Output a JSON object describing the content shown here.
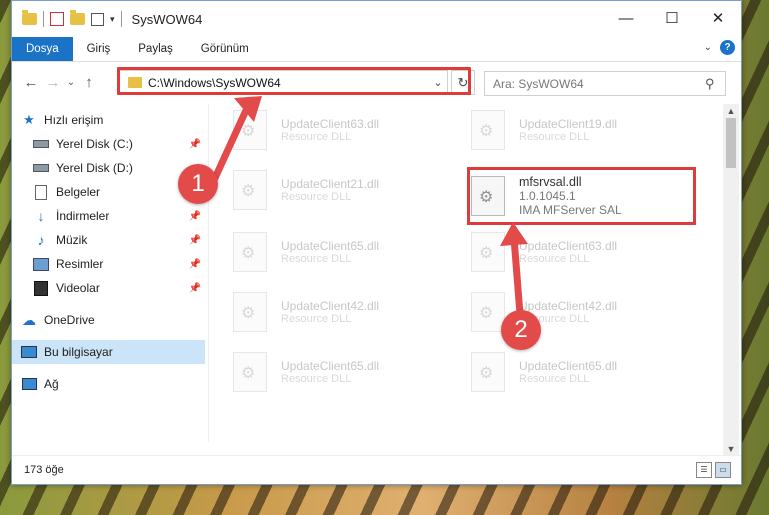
{
  "window": {
    "title": "SysWOW64",
    "controls": {
      "minimize": "—",
      "maximize": "☐",
      "close": "✕"
    }
  },
  "ribbon": {
    "tabs": [
      "Dosya",
      "Giriş",
      "Paylaş",
      "Görünüm"
    ],
    "expand_icon": "chevron-down-icon",
    "help_label": "?"
  },
  "nav": {
    "back": "←",
    "forward": "→",
    "recent": "⌄",
    "up": "↑"
  },
  "address": {
    "path": "C:\\Windows\\SysWOW64",
    "refresh": "↻",
    "dropdown": "⌄"
  },
  "search": {
    "placeholder": "Ara: SysWOW64",
    "icon": "⚲"
  },
  "sidebar": {
    "items": [
      {
        "label": "Hızlı erişim",
        "icon": "star-icon"
      },
      {
        "label": "Yerel Disk (C:)",
        "icon": "drive-icon",
        "pinned": true
      },
      {
        "label": "Yerel Disk (D:)",
        "icon": "drive-icon"
      },
      {
        "label": "Belgeler",
        "icon": "documents-icon",
        "pinned": true
      },
      {
        "label": "İndirmeler",
        "icon": "download-icon",
        "pinned": true
      },
      {
        "label": "Müzik",
        "icon": "music-icon",
        "pinned": true
      },
      {
        "label": "Resimler",
        "icon": "pictures-icon",
        "pinned": true
      },
      {
        "label": "Videolar",
        "icon": "videos-icon",
        "pinned": true
      },
      {
        "label": "OneDrive",
        "icon": "cloud-icon"
      },
      {
        "label": "Bu bilgisayar",
        "icon": "computer-icon",
        "selected": true
      },
      {
        "label": "Ağ",
        "icon": "network-icon"
      }
    ]
  },
  "files": [
    {
      "name": "UpdateClient63.dll",
      "type": "Resource DLL"
    },
    {
      "name": "UpdateClient19.dll",
      "type": "Resource DLL"
    },
    {
      "name": "UpdateClient21.dll",
      "type": "Resource DLL"
    },
    {
      "name": "mfsrvsal.dll",
      "version": "1.0.1045.1",
      "company": "IMA MFServer SAL",
      "highlighted": true
    },
    {
      "name": "UpdateClient65.dll",
      "type": "Resource DLL"
    },
    {
      "name": "UpdateClient63.dll",
      "type": "Resource DLL"
    },
    {
      "name": "UpdateClient42.dll",
      "type": "Resource DLL"
    },
    {
      "name": "UpdateClient42.dll",
      "type": "Resource DLL"
    },
    {
      "name": "UpdateClient65.dll",
      "type": "Resource DLL"
    },
    {
      "name": "UpdateClient65.dll",
      "type": "Resource DLL"
    }
  ],
  "status": {
    "count": "173 öğe"
  },
  "callouts": [
    "1",
    "2"
  ],
  "colors": {
    "accent": "#1a73c6",
    "annotation": "#e03b3b"
  }
}
